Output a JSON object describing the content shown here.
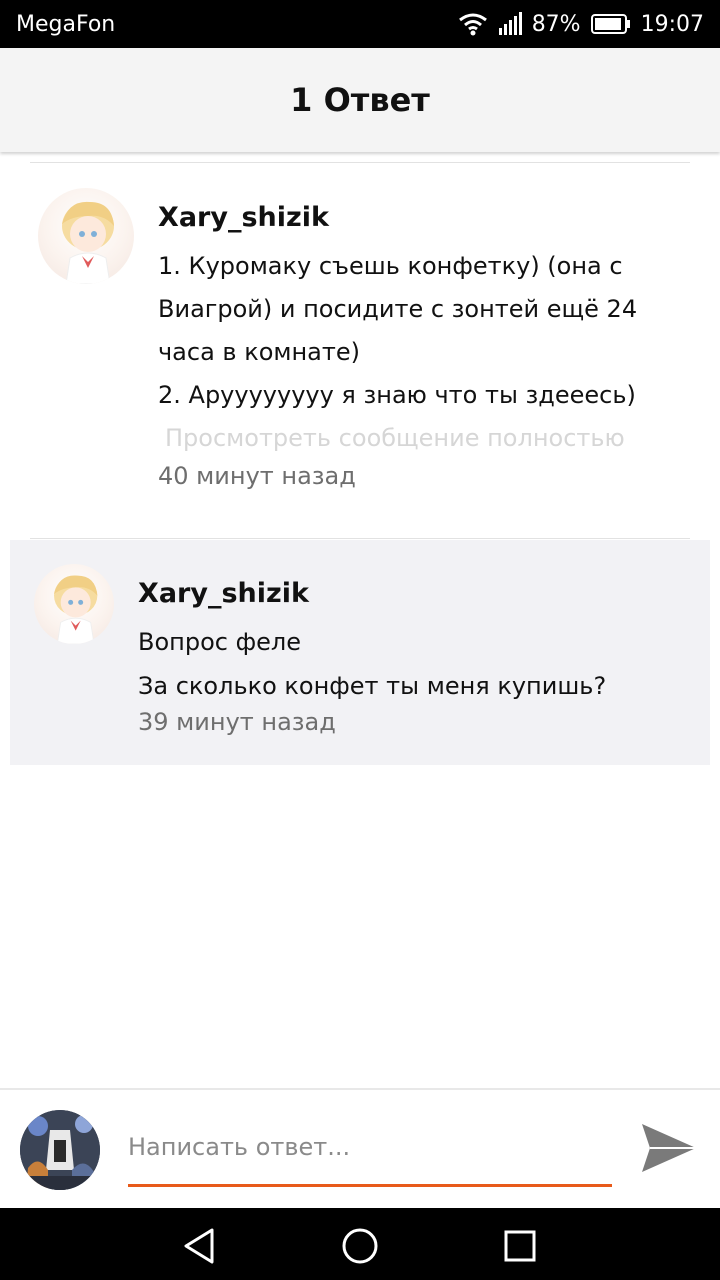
{
  "status_bar": {
    "carrier": "MegaFon",
    "battery": "87%",
    "time": "19:07",
    "icons": [
      "wifi-icon",
      "signal-icon",
      "battery-icon"
    ]
  },
  "header": {
    "title": "1 Ответ"
  },
  "comments": [
    {
      "username": "Xary_shizik",
      "lines": [
        "1. Куромаку съешь конфетку) (она с",
        "Виагрой) и посидите с зонтей ещё 24",
        "часа в комнате)",
        "2. Аруууууууу я знаю что ты здееесь)"
      ],
      "view_full": "Просмотреть сообщение полностью",
      "time": "40 минут назад"
    },
    {
      "username": "Xary_shizik",
      "lines": [
        "Вопрос феле",
        "За сколько конфет ты меня купишь?"
      ],
      "time": "39 минут назад"
    }
  ],
  "reply": {
    "placeholder": "Написать ответ...",
    "send_icon": "send-icon"
  },
  "navbar": {
    "icons": [
      "back-icon",
      "home-icon",
      "recents-icon"
    ]
  },
  "colors": {
    "accent": "#e85a1a",
    "header_bg": "#f4f4f4",
    "highlight_bg": "#f2f2f5",
    "muted_text": "#6e6e6e",
    "faded_text": "#d6d6d6"
  }
}
